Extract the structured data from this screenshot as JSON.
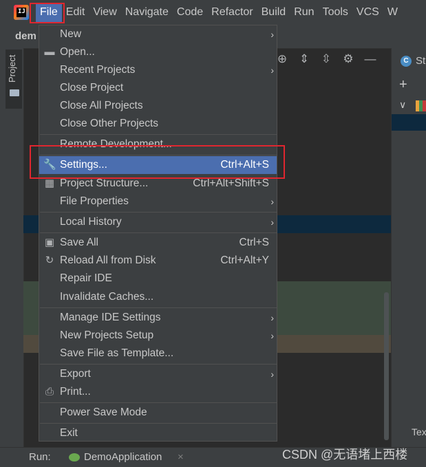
{
  "menubar": {
    "items": [
      "File",
      "Edit",
      "View",
      "Navigate",
      "Code",
      "Refactor",
      "Build",
      "Run",
      "Tools",
      "VCS",
      "W"
    ]
  },
  "project": {
    "name": "dem",
    "tab_label": "Project"
  },
  "right_panel": {
    "tab_label": "St",
    "bottom_text": "Tex"
  },
  "file_menu": {
    "new": {
      "label": "New"
    },
    "open": {
      "label": "Open..."
    },
    "recent_projects": {
      "label": "Recent Projects"
    },
    "close_project": {
      "label": "Close Project"
    },
    "close_all_projects": {
      "label": "Close All Projects"
    },
    "close_other_projects": {
      "label": "Close Other Projects"
    },
    "remote_development": {
      "label": "Remote Development..."
    },
    "settings": {
      "label": "Settings...",
      "shortcut": "Ctrl+Alt+S"
    },
    "project_structure": {
      "label": "Project Structure...",
      "shortcut": "Ctrl+Alt+Shift+S"
    },
    "file_properties": {
      "label": "File Properties"
    },
    "local_history": {
      "label": "Local History"
    },
    "save_all": {
      "label": "Save All",
      "shortcut": "Ctrl+S"
    },
    "reload_all": {
      "label": "Reload All from Disk",
      "shortcut": "Ctrl+Alt+Y"
    },
    "repair_ide": {
      "label": "Repair IDE"
    },
    "invalidate_caches": {
      "label": "Invalidate Caches..."
    },
    "manage_ide_settings": {
      "label": "Manage IDE Settings"
    },
    "new_projects_setup": {
      "label": "New Projects Setup"
    },
    "save_file_as_template": {
      "label": "Save File as Template..."
    },
    "export": {
      "label": "Export"
    },
    "print": {
      "label": "Print..."
    },
    "power_save_mode": {
      "label": "Power Save Mode"
    },
    "exit": {
      "label": "Exit"
    }
  },
  "run_bar": {
    "label": "Run:",
    "app": "DemoApplication",
    "close_glyph": "×"
  },
  "watermark": "CSDN @无语堵上西楼",
  "colors": {
    "selection": "#4b6eaf",
    "highlight_box": "#e0262f",
    "background": "#2b2b2b",
    "panel": "#3c3f41"
  }
}
